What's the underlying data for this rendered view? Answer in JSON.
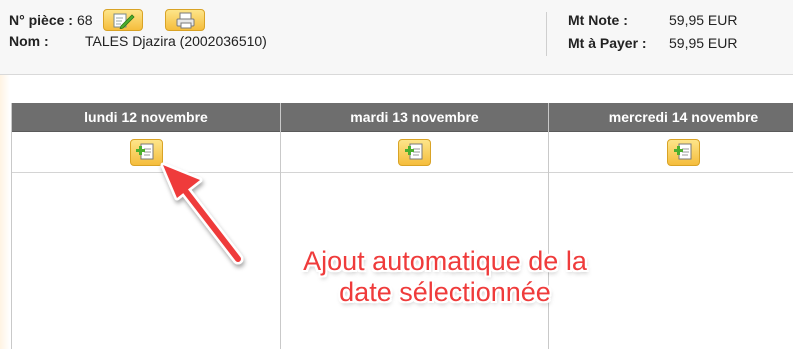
{
  "header": {
    "piece_label": "N° pièce :",
    "piece_number": "68",
    "nom_label": "Nom :",
    "nom_value": "TALES Djazira (2002036510)",
    "mt_note_label": "Mt Note :",
    "mt_note_value": "59,95 EUR",
    "mt_payer_label": "Mt à Payer :",
    "mt_payer_value": "59,95 EUR"
  },
  "calendar": {
    "days": [
      {
        "label": "lundi 12 novembre"
      },
      {
        "label": "mardi 13 novembre"
      },
      {
        "label": "mercredi 14 novembre"
      }
    ]
  },
  "annotation": {
    "line1": "Ajout automatique de la",
    "line2": "date sélectionnée",
    "color": "#ef3b3b"
  },
  "colors": {
    "button_gold": "#f5bd3c",
    "column_header": "#6e6e6e"
  }
}
